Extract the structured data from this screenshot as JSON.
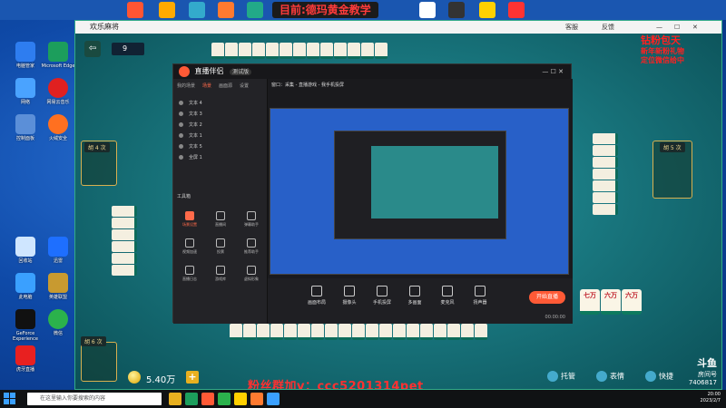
{
  "desktop": {
    "banner": "目前:德玛黄金教学",
    "icons": [
      {
        "label": "电脑管家"
      },
      {
        "label": "Microsoft Edge"
      },
      {
        "label": "网络"
      },
      {
        "label": "网易云音乐"
      },
      {
        "label": "控制面板"
      },
      {
        "label": "火绒安全"
      },
      {
        "label": "回收站"
      },
      {
        "label": "迅雷"
      },
      {
        "label": "此电脑"
      },
      {
        "label": "英雄联盟"
      },
      {
        "label": "GeForce Experience"
      },
      {
        "label": "微信"
      },
      {
        "label": "虎牙直播"
      }
    ],
    "right_overlay": [
      "钻粉包天",
      "新年新粉礼物",
      "定位微信给中"
    ]
  },
  "game": {
    "title": "欢乐麻将",
    "top_right": {
      "service": "客服",
      "feedback": "反馈"
    },
    "level_badge": "9",
    "players": {
      "left": "胡 4 次",
      "right": "胡 5 次",
      "bottom": "胡 6 次"
    },
    "coins": "5.40万",
    "plus": "+",
    "bottom_actions": {
      "trustee": "托管",
      "emoji": "表情",
      "chat": "快捷"
    },
    "wechat_ad": "粉丝群加v：ccc5201314pet",
    "big_tiles": [
      "七万",
      "六万",
      "六万"
    ],
    "watermark": {
      "brand": "斗鱼",
      "sub": "房间号",
      "room": "7406817"
    }
  },
  "stream_app": {
    "title": "直播伴侣",
    "version_badge": "测试版",
    "side_tabs": [
      "我的场景",
      "场景",
      "画面源",
      "设置"
    ],
    "scenes": [
      "文本 4",
      "文本 3",
      "文本 2",
      "文本 1",
      "文本 5",
      "全屏 1"
    ],
    "tools_title": "工具箱",
    "tools": [
      {
        "label": "场景设置",
        "active": true
      },
      {
        "label": "直播间",
        "active": false
      },
      {
        "label": "弹幕助手",
        "active": false
      },
      {
        "label": "视频加速",
        "active": false
      },
      {
        "label": "投票",
        "active": false
      },
      {
        "label": "推荐助手",
        "active": false
      },
      {
        "label": "直播日志",
        "active": false
      },
      {
        "label": "游戏库",
        "active": false
      },
      {
        "label": "虚拟形象",
        "active": false
      }
    ],
    "topbar": "窗口：采集 - 直播游戏 - 我手机投屏",
    "footer_buttons": [
      "画面布局",
      "摄像头",
      "手机投屏",
      "多画面",
      "麦克风",
      "扬声器"
    ],
    "go_live": "开始直播",
    "live_time": "00:00:00"
  },
  "taskbar": {
    "search_placeholder": "在这里输入你要搜索的内容",
    "time": "20:00",
    "date": "2023/2/7"
  }
}
